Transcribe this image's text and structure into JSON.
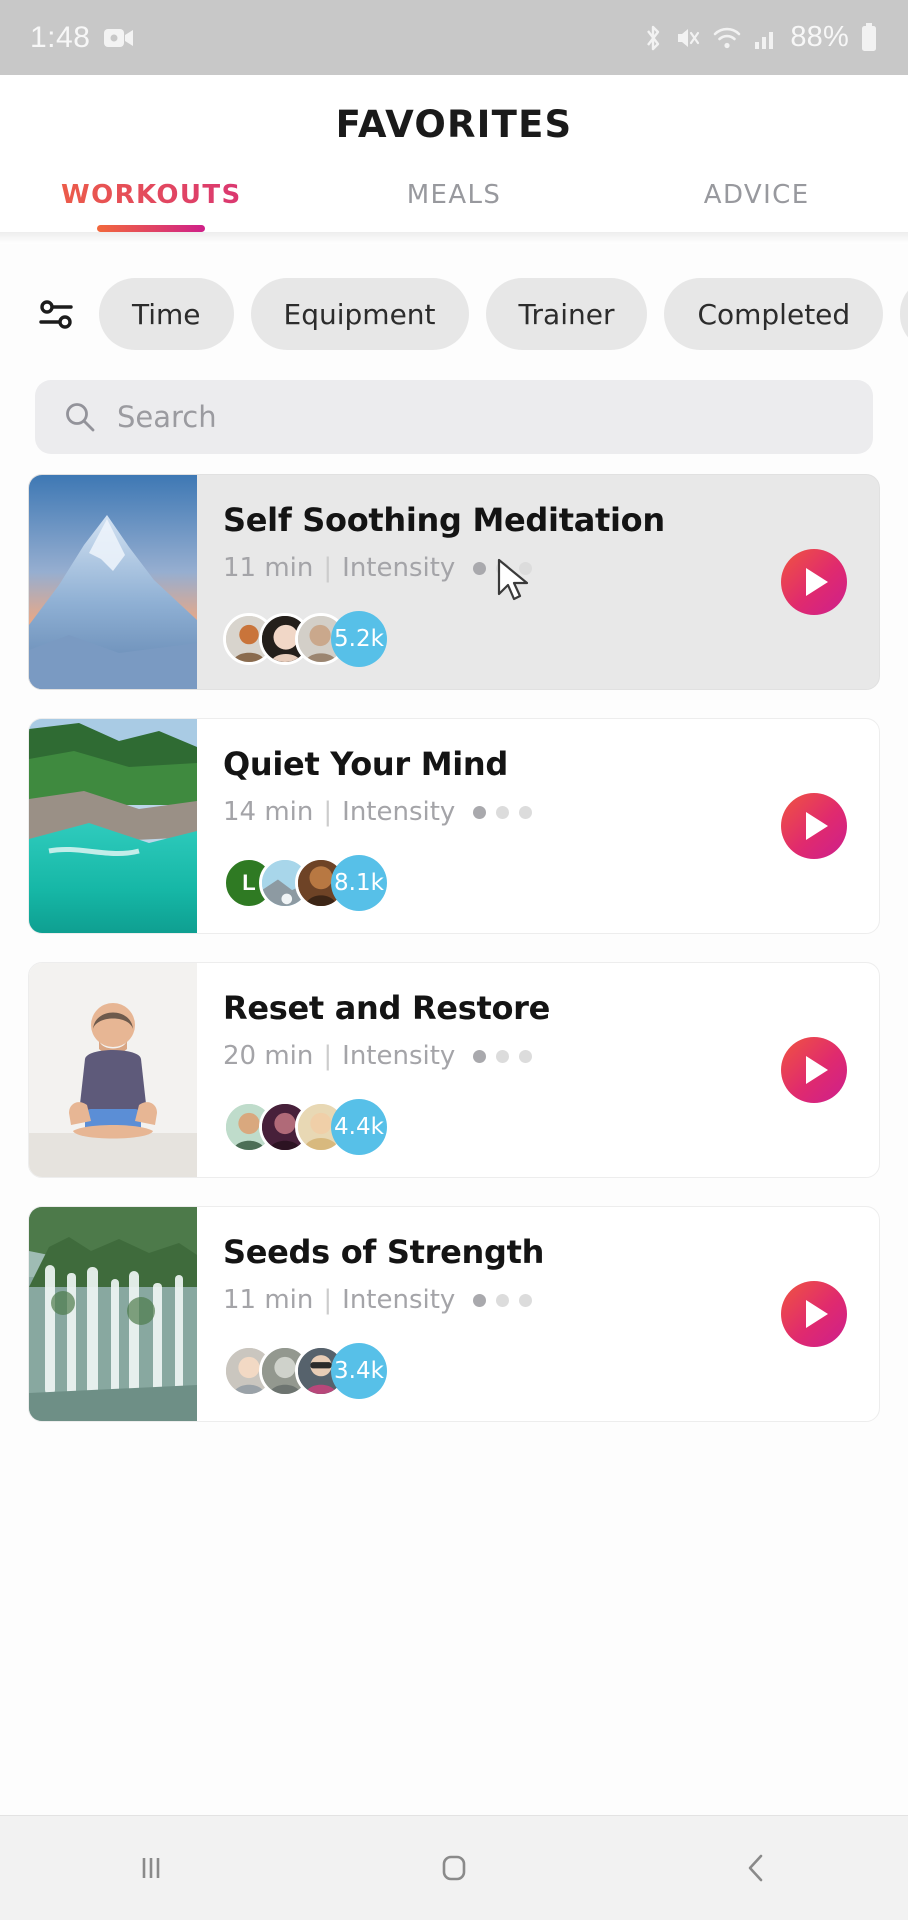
{
  "statusbar": {
    "time": "1:48",
    "battery": "88%",
    "icons": [
      "screen-record-icon",
      "bluetooth-icon",
      "mute-icon",
      "wifi-icon",
      "signal-icon",
      "battery-icon"
    ]
  },
  "header": {
    "title": "FAVORITES",
    "tabs": [
      {
        "label": "WORKOUTS",
        "active": true
      },
      {
        "label": "MEALS",
        "active": false
      },
      {
        "label": "ADVICE",
        "active": false
      }
    ]
  },
  "filters": {
    "icon": "filter-sliders-icon",
    "chips": [
      "Time",
      "Equipment",
      "Trainer",
      "Completed",
      ""
    ]
  },
  "search": {
    "placeholder": "Search",
    "value": "",
    "icon": "search-icon"
  },
  "cards": [
    {
      "title": "Self Soothing Meditation",
      "duration": "11 min",
      "intensity_label": "Intensity",
      "intensity_level": 1,
      "intensity_max": 3,
      "separator": "|",
      "count": "5.2k",
      "hovered": true,
      "thumb": "snowy-mountain-sunset"
    },
    {
      "title": "Quiet Your Mind",
      "duration": "14 min",
      "intensity_label": "Intensity",
      "intensity_level": 1,
      "intensity_max": 3,
      "separator": "|",
      "count": "8.1k",
      "hovered": false,
      "thumb": "tropical-coastline",
      "avatar_initial": "L"
    },
    {
      "title": "Reset and Restore",
      "duration": "20 min",
      "intensity_label": "Intensity",
      "intensity_level": 1,
      "intensity_max": 3,
      "separator": "|",
      "count": "4.4k",
      "hovered": false,
      "thumb": "man-seated-meditation"
    },
    {
      "title": "Seeds of Strength",
      "duration": "11 min",
      "intensity_label": "Intensity",
      "intensity_level": 1,
      "intensity_max": 3,
      "separator": "|",
      "count": "3.4k",
      "hovered": false,
      "thumb": "waterfalls-jungle"
    }
  ],
  "navbar": {
    "recents_label": "|||",
    "home_label": "home-icon",
    "back_label": "back-icon"
  },
  "colors": {
    "accent_start": "#f2683c",
    "accent_end": "#cf2089",
    "count_badge": "#57c0e8",
    "chip_bg": "#e7e7e7",
    "search_bg": "#ececee"
  }
}
